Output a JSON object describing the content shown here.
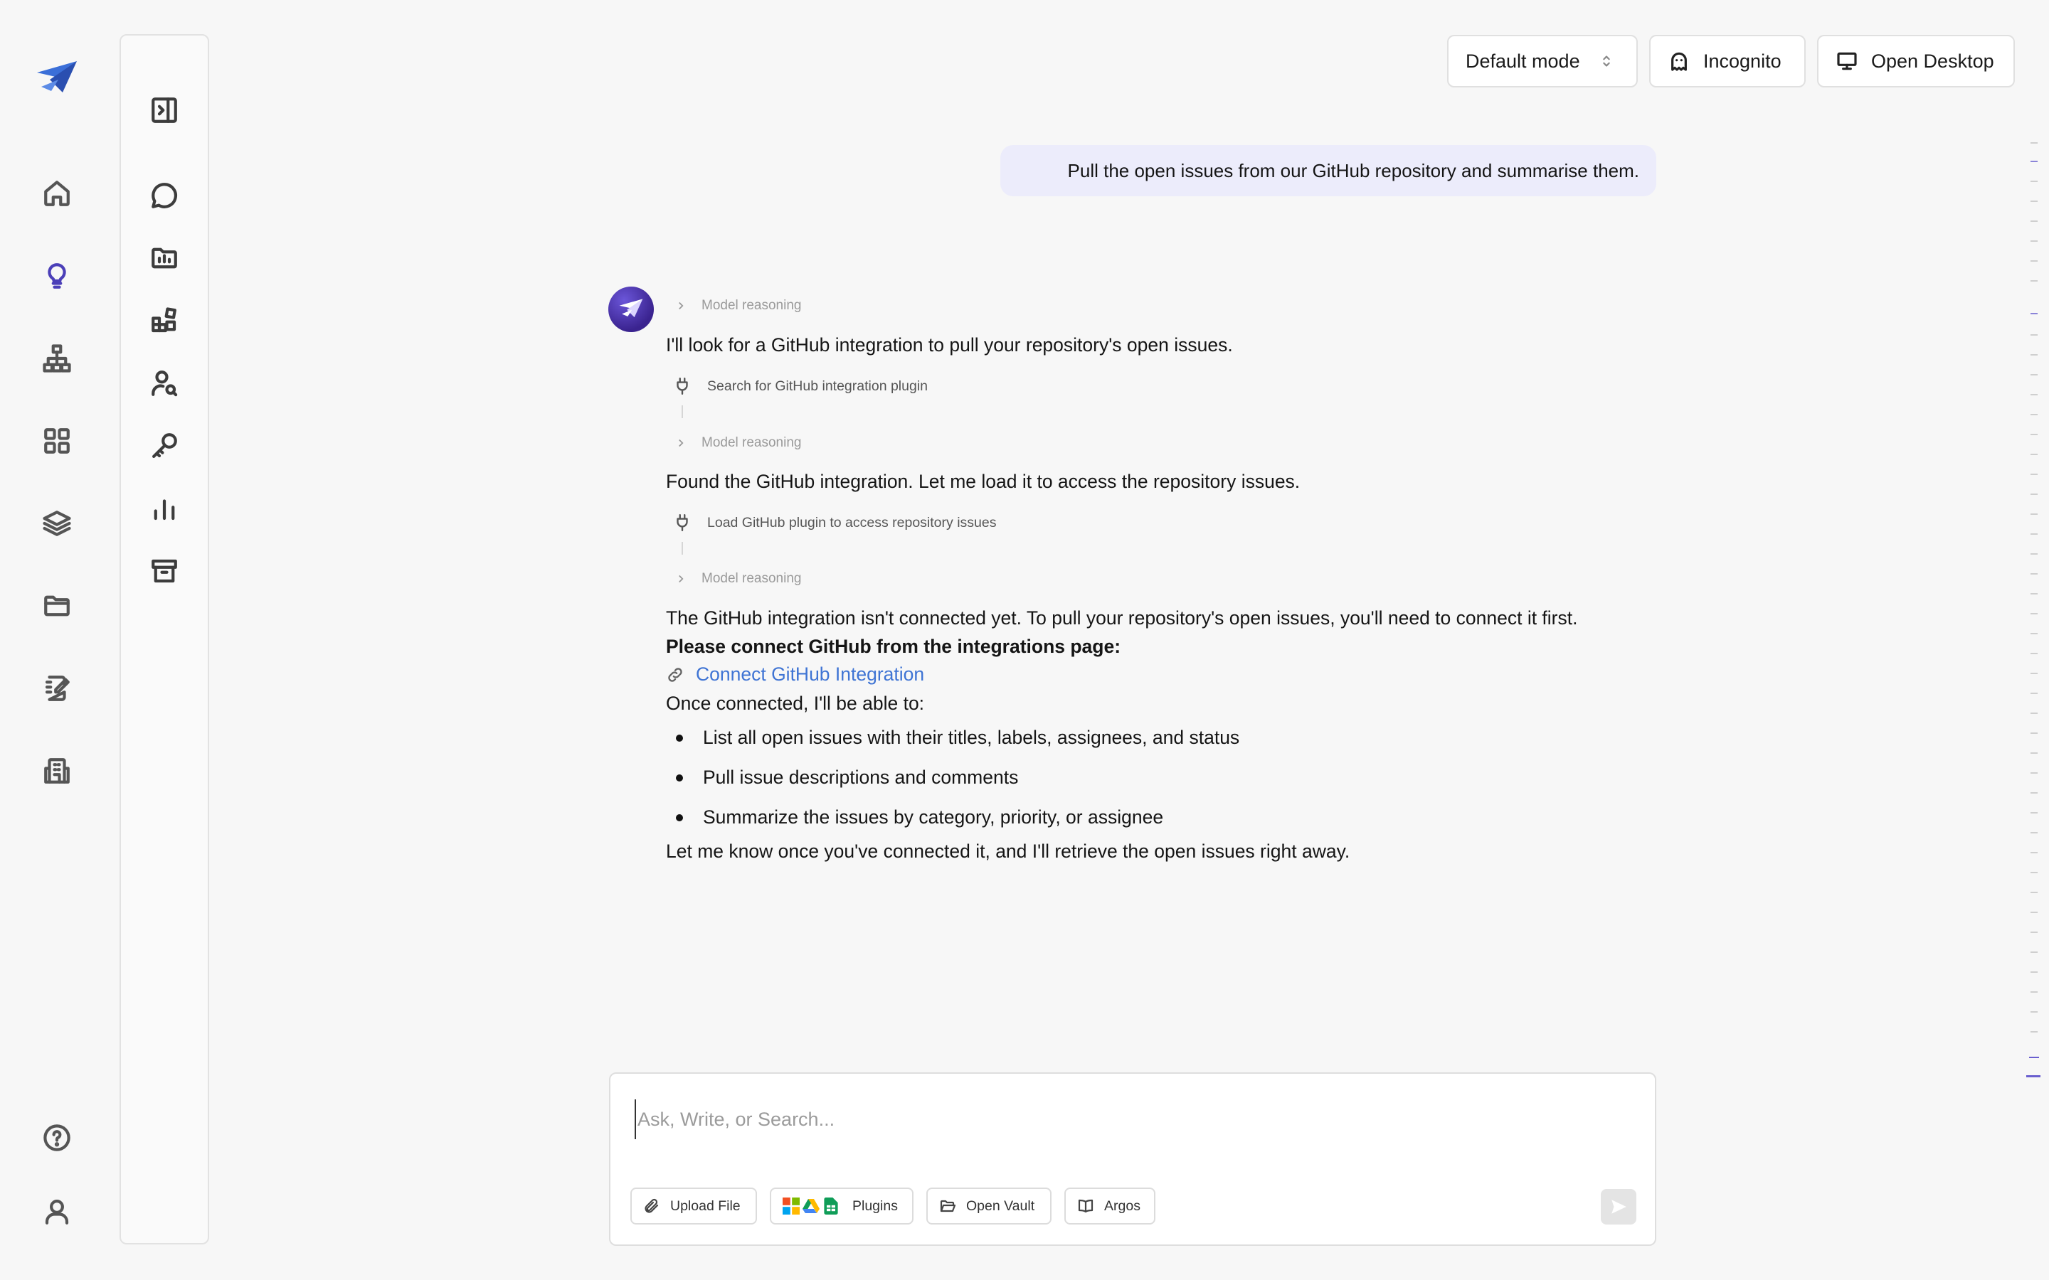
{
  "top_bar": {
    "mode_label": "Default mode",
    "incognito_label": "Incognito",
    "open_desktop_label": "Open Desktop"
  },
  "chat": {
    "user_message": "Pull the open issues from our GitHub repository and summarise them.",
    "reasoning_label": "Model reasoning",
    "assistant_1": "I'll look for a GitHub integration to pull your repository's open issues.",
    "tool_1": "Search for GitHub integration plugin",
    "assistant_2": "Found the GitHub integration. Let me load it to access the repository issues.",
    "tool_2": "Load GitHub plugin to access repository issues",
    "assistant_3": "The GitHub integration isn't connected yet. To pull your repository's open issues, you'll need to connect it first.",
    "assistant_3_bold": "Please connect GitHub from the integrations page:",
    "link_label": "Connect GitHub Integration",
    "once_connected": "Once connected, I'll be able to:",
    "bullets": [
      "List all open issues with their titles, labels, assignees, and status",
      "Pull issue descriptions and comments",
      "Summarize the issues by category, priority, or assignee"
    ],
    "closing": "Let me know once you've connected it, and I'll retrieve the open issues right away."
  },
  "composer": {
    "placeholder": "Ask, Write, or Search...",
    "upload_label": "Upload File",
    "plugins_label": "Plugins",
    "vault_label": "Open Vault",
    "argos_label": "Argos"
  },
  "icons": {
    "rail": [
      "logo-icon",
      "home-icon",
      "lightbulb-icon",
      "sitemap-icon",
      "grid-icon",
      "layers-icon",
      "folder-icon",
      "notebook-icon",
      "building-icon",
      "help-icon",
      "user-icon"
    ],
    "panel": [
      "sidebar-toggle-icon",
      "chat-bubble-icon",
      "folder-chart-icon",
      "widgets-icon",
      "user-search-icon",
      "key-icon",
      "bar-chart-icon",
      "archive-icon"
    ]
  },
  "colors": {
    "accent": "#4b3fb8",
    "user_bubble": "#ececfb",
    "link": "#3f74d4",
    "background": "#f7f7f7"
  }
}
